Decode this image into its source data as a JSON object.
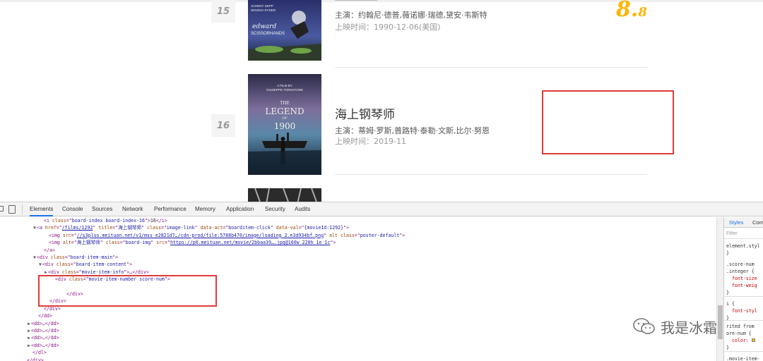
{
  "board": {
    "movies": [
      {
        "index": "15",
        "title": "",
        "star": "主演：约翰尼·德普,薇诺娜·瑞德,黛安·韦斯特",
        "release_time": "上映时间：1990-12-06(美国)",
        "score_integer": "8.",
        "score_fraction": "8",
        "poster_text": [
          "JOHNNY DEPP",
          "WINONA RYDER",
          "edward",
          "SCISSORHANDS"
        ]
      },
      {
        "index": "16",
        "title": "海上钢琴师",
        "star": "主演：蒂姆·罗斯,普路特·泰勒·文斯,比尔·努恩",
        "release_time": "上映时间：2019-11",
        "poster_text": [
          "A FILM BY",
          "GIUSEPPE TORNATORE",
          "THE",
          "LEGEND",
          "OF",
          "1900"
        ]
      }
    ]
  },
  "devtools": {
    "tabs": [
      "Elements",
      "Console",
      "Sources",
      "Network",
      "Performance",
      "Memory",
      "Application",
      "Security",
      "Audits"
    ],
    "active_tab": "Elements",
    "lines": [
      {
        "indent": 62,
        "parts": [
          [
            "tag",
            "<i "
          ],
          [
            "an",
            "class"
          ],
          [
            "tag",
            "=\""
          ],
          [
            "av",
            "board-index board-index-16"
          ],
          [
            "tag",
            "\">"
          ],
          [
            "tx",
            "16"
          ],
          [
            "tag",
            "</i>"
          ]
        ]
      },
      {
        "indent": 54,
        "tri": "▼",
        "parts": [
          [
            "tag",
            "<a "
          ],
          [
            "an",
            "href"
          ],
          [
            "tag",
            "=\""
          ],
          [
            "lk",
            "/films/1292"
          ],
          [
            "tag",
            "\" "
          ],
          [
            "an",
            "title"
          ],
          [
            "tag",
            "=\""
          ],
          [
            "av",
            "海上钢琴师"
          ],
          [
            "tag",
            "\" "
          ],
          [
            "an",
            "class"
          ],
          [
            "tag",
            "=\""
          ],
          [
            "av",
            "image-link"
          ],
          [
            "tag",
            "\" "
          ],
          [
            "an",
            "data-act"
          ],
          [
            "tag",
            "=\""
          ],
          [
            "av",
            "boarditem-click"
          ],
          [
            "tag",
            "\" "
          ],
          [
            "an",
            "data-val"
          ],
          [
            "tag",
            "=\""
          ],
          [
            "av",
            "{movieId:1292}"
          ],
          [
            "tag",
            "\">"
          ]
        ]
      },
      {
        "indent": 69,
        "parts": [
          [
            "tag",
            "<img "
          ],
          [
            "an",
            "src"
          ],
          [
            "tag",
            "=\""
          ],
          [
            "lk",
            "//s3plus.meituan.net/v1/mss_e2821d7…/cdn-prod/file:5788b470/image/loading_2.e3d934bf.png"
          ],
          [
            "tag",
            "\" "
          ],
          [
            "an",
            "alt"
          ],
          [
            "tag",
            " "
          ],
          [
            "an",
            "class"
          ],
          [
            "tag",
            "=\""
          ],
          [
            "av",
            "poster-default"
          ],
          [
            "tag",
            "\">"
          ]
        ]
      },
      {
        "indent": 69,
        "parts": [
          [
            "tag",
            "<img "
          ],
          [
            "an",
            "alt"
          ],
          [
            "tag",
            "=\""
          ],
          [
            "av",
            "海上钢琴师"
          ],
          [
            "tag",
            "\" "
          ],
          [
            "an",
            "class"
          ],
          [
            "tag",
            "=\""
          ],
          [
            "av",
            "board-img"
          ],
          [
            "tag",
            "\" "
          ],
          [
            "an",
            "src"
          ],
          [
            "tag",
            "=\""
          ],
          [
            "lk",
            "https://p0.meituan.net/movie/2bbaa39….jpg@160w_220h_1e_1c"
          ],
          [
            "tag",
            "\">"
          ]
        ]
      },
      {
        "indent": 62,
        "parts": [
          [
            "tag",
            "</a>"
          ]
        ]
      },
      {
        "indent": 54,
        "tri": "▼",
        "parts": [
          [
            "tag",
            "<div "
          ],
          [
            "an",
            "class"
          ],
          [
            "tag",
            "=\""
          ],
          [
            "av",
            "board-item-main"
          ],
          [
            "tag",
            "\">"
          ]
        ]
      },
      {
        "indent": 62,
        "tri": "▼",
        "parts": [
          [
            "tag",
            "<div "
          ],
          [
            "an",
            "class"
          ],
          [
            "tag",
            "=\""
          ],
          [
            "av",
            "board-item-content"
          ],
          [
            "tag",
            "\">"
          ]
        ]
      },
      {
        "indent": 70,
        "tri": "▶",
        "parts": [
          [
            "tag",
            "<div "
          ],
          [
            "an",
            "class"
          ],
          [
            "tag",
            "=\""
          ],
          [
            "av",
            "movie-item-info"
          ],
          [
            "tag",
            "\">…</div>"
          ]
        ]
      },
      {
        "indent": 78,
        "parts": [
          [
            "tag",
            "<div "
          ],
          [
            "an",
            "class"
          ],
          [
            "tag",
            "=\""
          ],
          [
            "av",
            "movie-item-number score-num"
          ],
          [
            "tag",
            "\">"
          ]
        ]
      },
      {
        "indent": 78,
        "parts": [
          [
            "tag",
            " "
          ]
        ]
      },
      {
        "indent": 94,
        "parts": [
          [
            "tag",
            "</div>"
          ]
        ]
      },
      {
        "indent": 70,
        "parts": [
          [
            "tag",
            "</div>"
          ]
        ]
      },
      {
        "indent": 62,
        "parts": [
          [
            "tag",
            "</div>"
          ]
        ]
      },
      {
        "indent": 54,
        "parts": [
          [
            "tag",
            "</dd>"
          ]
        ]
      },
      {
        "indent": 46,
        "tri": "▶",
        "parts": [
          [
            "tag",
            "<dd>…</dd>"
          ]
        ]
      },
      {
        "indent": 46,
        "tri": "▶",
        "parts": [
          [
            "tag",
            "<dd>…</dd>"
          ]
        ]
      },
      {
        "indent": 46,
        "tri": "▶",
        "parts": [
          [
            "tag",
            "<dd>…</dd>"
          ]
        ]
      },
      {
        "indent": 46,
        "tri": "▶",
        "parts": [
          [
            "tag",
            "<dd>…</dd>"
          ]
        ]
      },
      {
        "indent": 46,
        "parts": [
          [
            "tag",
            "</dl>"
          ]
        ]
      },
      {
        "indent": 38,
        "parts": [
          [
            "tag",
            "</div>"
          ]
        ]
      }
    ],
    "styles_panel": {
      "tabs": [
        "Styles",
        "Com"
      ],
      "filter_placeholder": "Filter",
      "lines": [
        {
          "t": "element.styl",
          "c": "tx"
        },
        {
          "t": "}",
          "c": "tx"
        },
        {
          "t": ".score-num",
          "c": "tx"
        },
        {
          "t": ".integer {",
          "c": "tx"
        },
        {
          "t": "  font-size",
          "c": "prop"
        },
        {
          "t": "  font-weig",
          "c": "prop"
        },
        {
          "t": "}",
          "c": "tx"
        },
        {
          "t": "i {",
          "c": "tx"
        },
        {
          "t": "  font-styl",
          "c": "prop"
        },
        {
          "t": "}",
          "c": "tx"
        },
        {
          "t": "rited from",
          "c": "tx"
        },
        {
          "t": "ore-num {",
          "c": "tx"
        },
        {
          "t": "  color: ",
          "c": "prop"
        },
        {
          "t": "}",
          "c": "tx"
        },
        {
          "t": ".movie-item-",
          "c": "tx"
        }
      ]
    }
  },
  "watermark": {
    "text": "我是冰霜",
    "icon": "wechat-icon"
  },
  "colors": {
    "score": "#ffb400",
    "highlight_box": "#e03b3b",
    "devtools_active": "#1a73e8"
  }
}
